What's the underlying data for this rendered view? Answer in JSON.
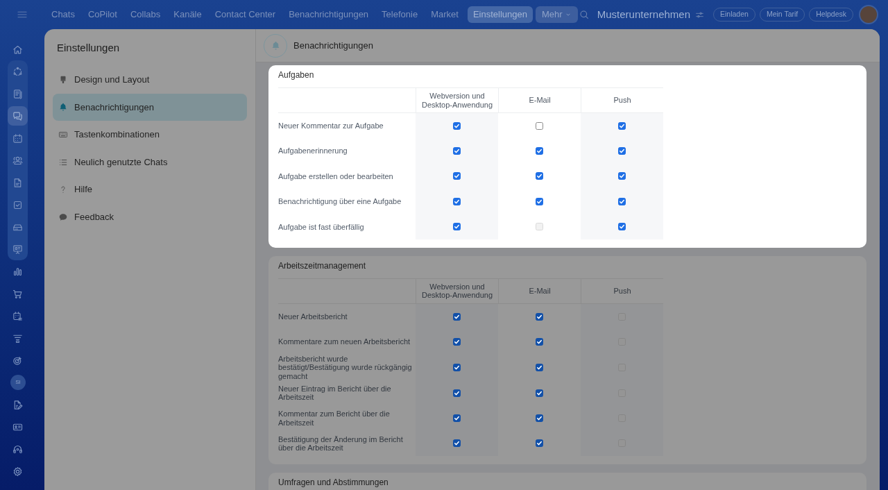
{
  "topbar": {
    "tabs": [
      {
        "label": "Chats",
        "selected": false
      },
      {
        "label": "CoPilot",
        "selected": false
      },
      {
        "label": "Collabs",
        "selected": false
      },
      {
        "label": "Kanäle",
        "selected": false
      },
      {
        "label": "Contact Center",
        "selected": false
      },
      {
        "label": "Benachrichtigungen",
        "selected": false
      },
      {
        "label": "Telefonie",
        "selected": false
      },
      {
        "label": "Market",
        "selected": false
      },
      {
        "label": "Einstellungen",
        "selected": true
      }
    ],
    "more": {
      "label": "Mehr"
    },
    "company": "Musterunternehmen",
    "buttons": [
      "Einladen",
      "Mein Tarif",
      "Helpdesk"
    ]
  },
  "rail": {
    "top": [
      {
        "selected": false
      }
    ],
    "pinned": [
      {
        "selected": false
      },
      {
        "selected": false
      },
      {
        "selected": true
      },
      {
        "selected": false
      },
      {
        "selected": false
      },
      {
        "selected": false
      },
      {
        "selected": false
      },
      {
        "selected": false
      },
      {
        "selected": false
      }
    ],
    "more": [
      {
        "selected": false
      },
      {
        "selected": false
      },
      {
        "selected": false
      },
      {
        "selected": false
      },
      {
        "selected": false
      },
      {
        "selected": false,
        "initials": "SI"
      },
      {
        "selected": false
      },
      {
        "selected": false
      },
      {
        "selected": false
      },
      {
        "selected": false
      }
    ]
  },
  "settings": {
    "title": "Einstellungen",
    "items": [
      {
        "label": "Design und Layout",
        "selected": false
      },
      {
        "label": "Benachrichtigungen",
        "selected": true
      },
      {
        "label": "Tastenkombinationen",
        "selected": false
      },
      {
        "label": "Neulich genutzte Chats",
        "selected": false
      },
      {
        "label": "Hilfe",
        "selected": false
      },
      {
        "label": "Feedback",
        "selected": false
      }
    ]
  },
  "content": {
    "title": "Benachrichtigungen",
    "sections": [
      {
        "title": "Aufgaben",
        "highlighted": true,
        "columns": [
          "Webversion und Desktop-Anwendung",
          "E-Mail",
          "Push"
        ],
        "rows": [
          {
            "label": "Neuer Kommentar zur Aufgabe",
            "options": [
              {
                "checked": true,
                "disabled": false
              },
              {
                "checked": false,
                "disabled": false
              },
              {
                "checked": true,
                "disabled": false
              }
            ]
          },
          {
            "label": "Aufgabenerinnerung",
            "options": [
              {
                "checked": true,
                "disabled": false
              },
              {
                "checked": true,
                "disabled": false
              },
              {
                "checked": true,
                "disabled": false
              }
            ]
          },
          {
            "label": "Aufgabe erstellen oder bearbeiten",
            "options": [
              {
                "checked": true,
                "disabled": false
              },
              {
                "checked": true,
                "disabled": false
              },
              {
                "checked": true,
                "disabled": false
              }
            ]
          },
          {
            "label": "Benachrichtigung über eine Aufgabe",
            "options": [
              {
                "checked": true,
                "disabled": false
              },
              {
                "checked": true,
                "disabled": false
              },
              {
                "checked": true,
                "disabled": false
              }
            ]
          },
          {
            "label": "Aufgabe ist fast überfällig",
            "options": [
              {
                "checked": true,
                "disabled": false
              },
              {
                "checked": false,
                "disabled": true
              },
              {
                "checked": true,
                "disabled": false
              }
            ]
          }
        ]
      },
      {
        "title": "Arbeitszeitmanagement",
        "highlighted": false,
        "columns": [
          "Webversion und Desktop-Anwendung",
          "E-Mail",
          "Push"
        ],
        "rows": [
          {
            "label": "Neuer Arbeitsbericht",
            "options": [
              {
                "checked": true,
                "disabled": false
              },
              {
                "checked": true,
                "disabled": false
              },
              {
                "checked": false,
                "disabled": true
              }
            ]
          },
          {
            "label": "Kommentare zum neuen Arbeitsbericht",
            "options": [
              {
                "checked": true,
                "disabled": false
              },
              {
                "checked": true,
                "disabled": false
              },
              {
                "checked": false,
                "disabled": true
              }
            ]
          },
          {
            "label": "Arbeitsbericht wurde bestätigt/Bestätigung wurde rückgängig gemacht",
            "options": [
              {
                "checked": true,
                "disabled": false
              },
              {
                "checked": true,
                "disabled": false
              },
              {
                "checked": false,
                "disabled": true
              }
            ]
          },
          {
            "label": "Neuer Eintrag im Bericht über die Arbeitszeit",
            "options": [
              {
                "checked": true,
                "disabled": false
              },
              {
                "checked": true,
                "disabled": false
              },
              {
                "checked": false,
                "disabled": true
              }
            ]
          },
          {
            "label": "Kommentar zum Bericht über die Arbeitszeit",
            "options": [
              {
                "checked": true,
                "disabled": false
              },
              {
                "checked": true,
                "disabled": false
              },
              {
                "checked": false,
                "disabled": true
              }
            ]
          },
          {
            "label": "Bestätigung der Änderung im Bericht über die Arbeitszeit",
            "options": [
              {
                "checked": true,
                "disabled": false
              },
              {
                "checked": true,
                "disabled": false
              },
              {
                "checked": false,
                "disabled": true
              }
            ]
          }
        ]
      },
      {
        "title": "Umfragen und Abstimmungen",
        "highlighted": false
      }
    ]
  }
}
